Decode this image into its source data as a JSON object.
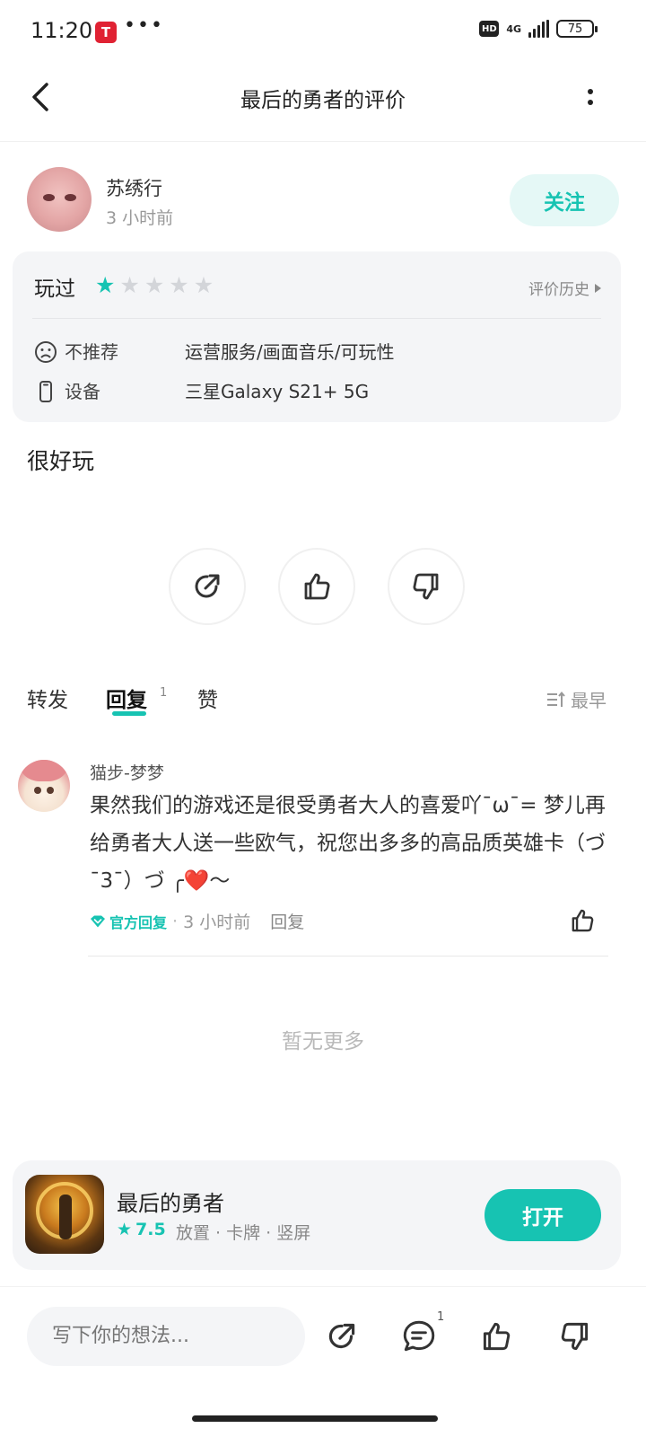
{
  "status_bar": {
    "time": "11:20",
    "app_badge": "T",
    "more_dots": "•••",
    "hd": "HD",
    "network": "4G",
    "battery": "75"
  },
  "nav": {
    "title": "最后的勇者的评价"
  },
  "author": {
    "name": "苏绣行",
    "time": "3 小时前",
    "follow_label": "关注"
  },
  "rating": {
    "played_label": "玩过",
    "stars_total": 5,
    "stars_filled": 1,
    "history_label": "评价历史",
    "recommend_label": "不推荐",
    "recommend_value": "运营服务/画面音乐/可玩性",
    "device_label": "设备",
    "device_value": "三星Galaxy S21+ 5G"
  },
  "review": {
    "text": "很好玩"
  },
  "tabs": {
    "repost": "转发",
    "reply": "回复",
    "reply_count": "1",
    "like": "赞",
    "sort_label": "最早"
  },
  "comment": {
    "user": "猫步-梦梦",
    "body": "果然我们的游戏还是很受勇者大人的喜爱吖ˉωˉ= 梦儿再给勇者大人送一些欧气，祝您出多多的高品质英雄卡（づˉ3ˉ）づ ╭❤️～",
    "official_label": "官方回复",
    "time": "3 小时前",
    "reply_label": "回复"
  },
  "no_more": "暂无更多",
  "game": {
    "name": "最后的勇者",
    "score": "7.5",
    "tags": "放置 · 卡牌 · 竖屏",
    "open_label": "打开"
  },
  "bottom_bar": {
    "input_placeholder": "写下你的想法...",
    "comment_count": "1"
  },
  "colors": {
    "accent": "#17c3b2",
    "accent_light": "#e5f8f6",
    "card_bg": "#f4f5f7"
  }
}
